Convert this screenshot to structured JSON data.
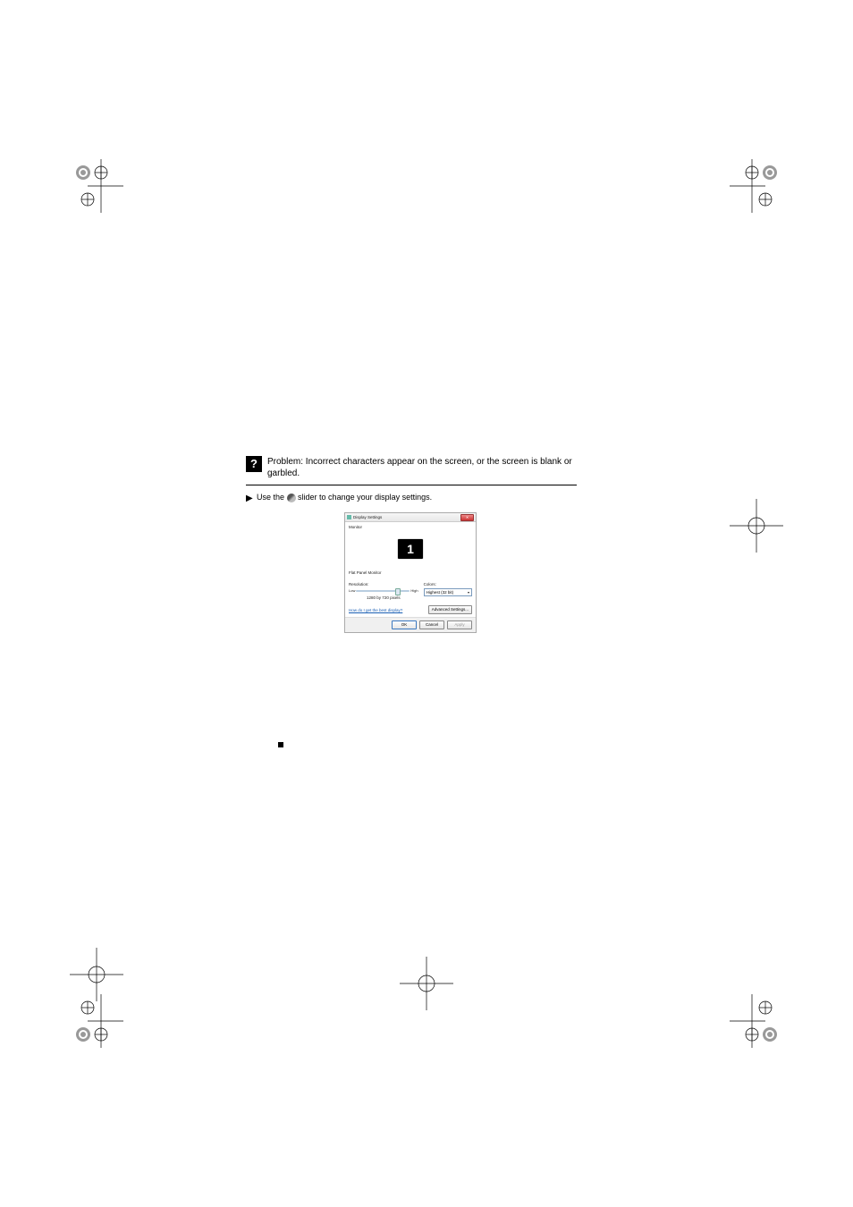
{
  "troubleshoot": {
    "question": "Problem: Incorrect characters appear on the screen, or the screen is blank or garbled.",
    "solution_prefix": "Use the ",
    "solution_icon_name": "power-profile-icon",
    "solution_suffix": " slider to change your display settings."
  },
  "dialog": {
    "title": "Display Settings",
    "tab": "Monitor",
    "monitor_number": "1",
    "monitor_name": "Flat Panel Monitor",
    "resolution_label": "Resolution:",
    "low_label": "Low",
    "high_label": "High",
    "resolution_value": "1280 by 720 pixels",
    "colors_label": "Colors:",
    "colors_value": "Highest (32 bit)",
    "help_link": "How do I get the best display?",
    "advanced_button": "Advanced Settings...",
    "ok": "OK",
    "cancel": "Cancel",
    "apply": "Apply"
  }
}
